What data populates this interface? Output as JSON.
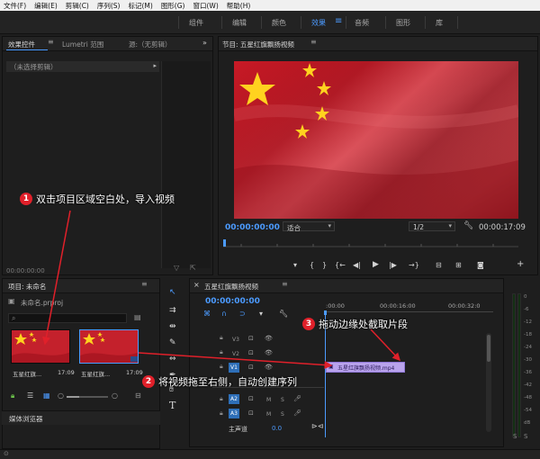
{
  "menu": [
    "文件(F)",
    "编辑(E)",
    "剪辑(C)",
    "序列(S)",
    "标记(M)",
    "图形(G)",
    "窗口(W)",
    "帮助(H)"
  ],
  "workspaces": [
    "组件",
    "编辑",
    "颜色",
    "效果",
    "音频",
    "图形",
    "库"
  ],
  "active_workspace": "效果",
  "effect_panel": {
    "tabs": [
      "效果控件",
      "Lumetri 范围",
      "源:（无剪辑）"
    ],
    "no_clip": "（未选择剪辑）",
    "timecode": "00:00:00:00"
  },
  "program": {
    "title": "节目: 五星红旗飘扬视频",
    "timecode": "00:00:00:00",
    "fit": "适合",
    "resolution": "1/2",
    "duration": "00:00:17:09"
  },
  "project": {
    "title": "项目: 未命名",
    "file": "未命名.prproj",
    "items": [
      {
        "name": "五星红旗...",
        "duration": "17:09"
      },
      {
        "name": "五星红旗...",
        "duration": "17:09"
      }
    ],
    "media_browser": "媒体浏览器"
  },
  "timeline": {
    "title": "五星红旗飘扬视频",
    "timecode": "00:00:00:00",
    "ruler": [
      ":00:00",
      "00:00:16:00",
      "00:00:32:0"
    ],
    "video_tracks": [
      "V3",
      "V2",
      "V1"
    ],
    "audio_tracks": [
      "A2",
      "A3"
    ],
    "master": "主声道",
    "master_value": "0.0",
    "clip_label": "五星红旗飘扬视频.mp4",
    "track_m": "M",
    "track_s": "S"
  },
  "meter": {
    "ticks": [
      "0",
      "-6",
      "-12",
      "-18",
      "-24",
      "-30",
      "-36",
      "-42",
      "-48",
      "-54",
      "dB"
    ]
  },
  "annotations": {
    "a1": {
      "num": "1",
      "text": "双击项目区域空白处，导入视频"
    },
    "a2": {
      "num": "2",
      "text": "将视频拖至右侧，自动创建序列"
    },
    "a3": {
      "num": "3",
      "text": "拖动边缘处截取片段"
    }
  },
  "colors": {
    "accent": "#4c9bff",
    "annotation": "#e0202a",
    "clip": "#b9a3ec"
  }
}
